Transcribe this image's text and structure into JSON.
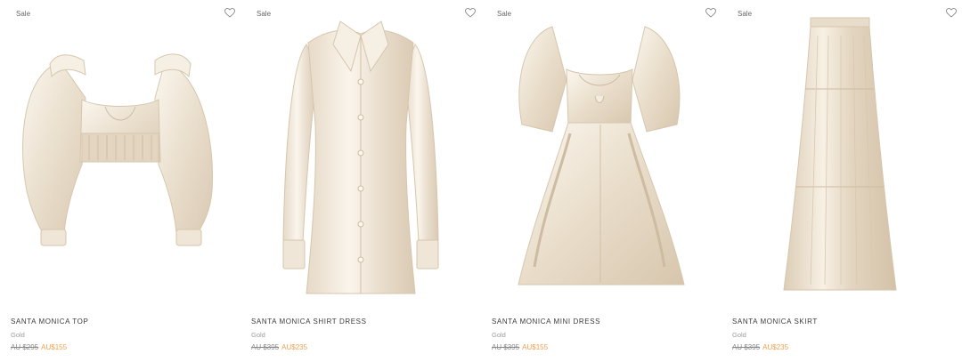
{
  "colors": {
    "sale_price": "#f0a150",
    "garment_base": "#efe6d8",
    "garment_shadow": "#d9c9b2",
    "garment_highlight": "#fbf7ef"
  },
  "products": [
    {
      "badge": "Sale",
      "name": "SANTA MONICA TOP",
      "color": "Gold",
      "price_original": "AU $295",
      "price_sale": "AU$155",
      "wishlist_icon": "heart-icon"
    },
    {
      "badge": "Sale",
      "name": "SANTA MONICA SHIRT DRESS",
      "color": "Gold",
      "price_original": "AU $395",
      "price_sale": "AU$235",
      "wishlist_icon": "heart-icon"
    },
    {
      "badge": "Sale",
      "name": "SANTA MONICA MINI DRESS",
      "color": "Gold",
      "price_original": "AU $395",
      "price_sale": "AU$155",
      "wishlist_icon": "heart-icon"
    },
    {
      "badge": "Sale",
      "name": "SANTA MONICA SKIRT",
      "color": "Gold",
      "price_original": "AU $395",
      "price_sale": "AU$235",
      "wishlist_icon": "heart-icon"
    }
  ]
}
